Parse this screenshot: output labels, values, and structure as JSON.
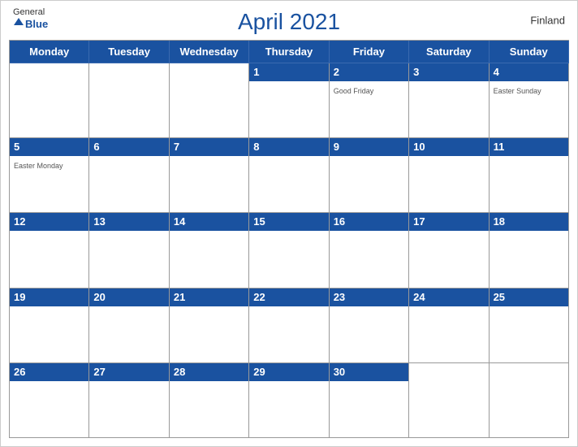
{
  "header": {
    "title": "April 2021",
    "country": "Finland",
    "logo": {
      "general": "General",
      "blue": "Blue"
    }
  },
  "days_of_week": [
    "Monday",
    "Tuesday",
    "Wednesday",
    "Thursday",
    "Friday",
    "Saturday",
    "Sunday"
  ],
  "weeks": [
    [
      {
        "num": "",
        "holiday": ""
      },
      {
        "num": "",
        "holiday": ""
      },
      {
        "num": "",
        "holiday": ""
      },
      {
        "num": "1",
        "holiday": ""
      },
      {
        "num": "2",
        "holiday": "Good Friday"
      },
      {
        "num": "3",
        "holiday": ""
      },
      {
        "num": "4",
        "holiday": "Easter Sunday"
      }
    ],
    [
      {
        "num": "5",
        "holiday": "Easter Monday"
      },
      {
        "num": "6",
        "holiday": ""
      },
      {
        "num": "7",
        "holiday": ""
      },
      {
        "num": "8",
        "holiday": ""
      },
      {
        "num": "9",
        "holiday": ""
      },
      {
        "num": "10",
        "holiday": ""
      },
      {
        "num": "11",
        "holiday": ""
      }
    ],
    [
      {
        "num": "12",
        "holiday": ""
      },
      {
        "num": "13",
        "holiday": ""
      },
      {
        "num": "14",
        "holiday": ""
      },
      {
        "num": "15",
        "holiday": ""
      },
      {
        "num": "16",
        "holiday": ""
      },
      {
        "num": "17",
        "holiday": ""
      },
      {
        "num": "18",
        "holiday": ""
      }
    ],
    [
      {
        "num": "19",
        "holiday": ""
      },
      {
        "num": "20",
        "holiday": ""
      },
      {
        "num": "21",
        "holiday": ""
      },
      {
        "num": "22",
        "holiday": ""
      },
      {
        "num": "23",
        "holiday": ""
      },
      {
        "num": "24",
        "holiday": ""
      },
      {
        "num": "25",
        "holiday": ""
      }
    ],
    [
      {
        "num": "26",
        "holiday": ""
      },
      {
        "num": "27",
        "holiday": ""
      },
      {
        "num": "28",
        "holiday": ""
      },
      {
        "num": "29",
        "holiday": ""
      },
      {
        "num": "30",
        "holiday": ""
      },
      {
        "num": "",
        "holiday": ""
      },
      {
        "num": "",
        "holiday": ""
      }
    ]
  ],
  "accent_color": "#1a52a0"
}
